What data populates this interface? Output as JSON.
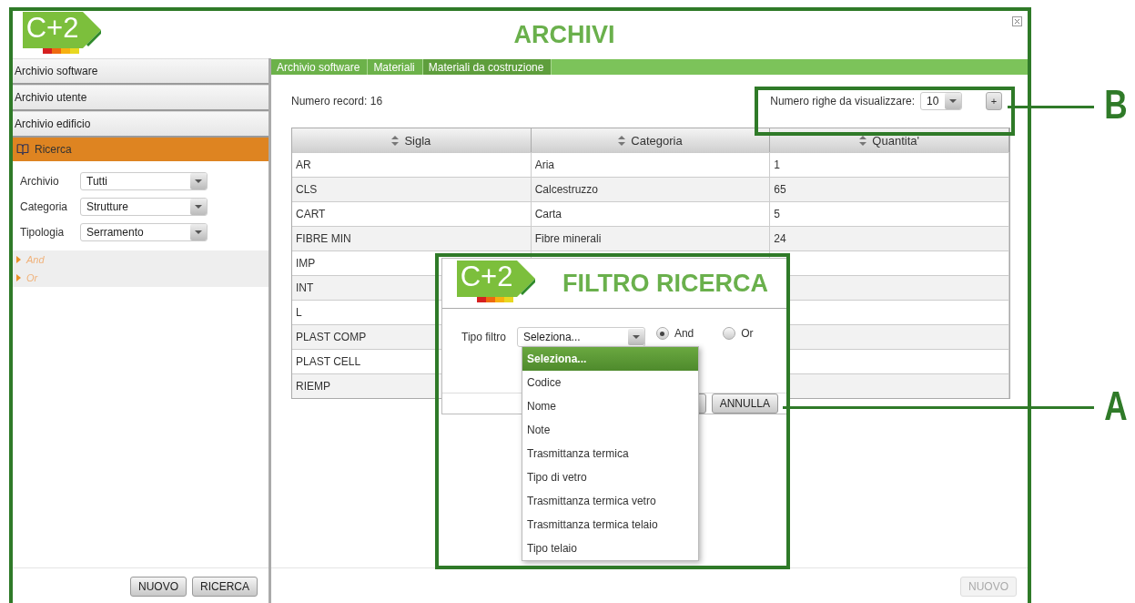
{
  "window": {
    "title": "ARCHIVI",
    "logo": "C+2"
  },
  "sidebar": {
    "sections": [
      {
        "label": "Archivio software"
      },
      {
        "label": "Archivio utente"
      },
      {
        "label": "Archivio edificio"
      }
    ],
    "search": {
      "title": "Ricerca",
      "fields": [
        {
          "label": "Archivio",
          "value": "Tutti"
        },
        {
          "label": "Categoria",
          "value": "Strutture"
        },
        {
          "label": "Tipologia",
          "value": "Serramento"
        }
      ],
      "operators": [
        {
          "label": "And"
        },
        {
          "label": "Or"
        }
      ],
      "buttons": [
        {
          "label": "NUOVO",
          "disabled": false
        },
        {
          "label": "RICERCA",
          "disabled": false
        }
      ]
    }
  },
  "main": {
    "breadcrumb": [
      {
        "label": "Archivio software",
        "selected": false
      },
      {
        "label": "Materiali",
        "selected": false
      },
      {
        "label": "Materiali da costruzione",
        "selected": true
      }
    ],
    "record_count": {
      "label": "Numero record:",
      "value": "16"
    },
    "rows_per_page": {
      "label": "Numero righe da visualizzare:",
      "value": "10",
      "button": "+"
    },
    "table": {
      "columns": [
        "Sigla",
        "Categoria",
        "Quantita'"
      ],
      "rows": [
        [
          "AR",
          "Aria",
          "1"
        ],
        [
          "CLS",
          "Calcestruzzo",
          "65"
        ],
        [
          "CART",
          "Carta",
          "5"
        ],
        [
          "FIBRE MIN",
          "Fibre minerali",
          "24"
        ],
        [
          "IMP"
        ],
        [
          "INT"
        ],
        [
          "L"
        ],
        [
          "PLAST COMP"
        ],
        [
          "PLAST CELL"
        ],
        [
          "RIEMP"
        ]
      ]
    },
    "footer_button": {
      "label": "NUOVO",
      "disabled": true
    }
  },
  "dialog": {
    "title": "FILTRO RICERCA",
    "logo": "C+2",
    "filter": {
      "label": "Tipo filtro",
      "value": "Seleziona..."
    },
    "radios": [
      {
        "label": "And",
        "selected": true
      },
      {
        "label": "Or",
        "selected": false
      }
    ],
    "buttons": [
      "ANNULLA"
    ],
    "dropdown": [
      {
        "label": "Seleziona...",
        "selected": true
      },
      {
        "label": "Codice",
        "selected": false
      },
      {
        "label": "Nome",
        "selected": false
      },
      {
        "label": "Note",
        "selected": false
      },
      {
        "label": "Trasmittanza termica",
        "selected": false
      },
      {
        "label": "Tipo di vetro",
        "selected": false
      },
      {
        "label": "Trasmittanza termica vetro",
        "selected": false
      },
      {
        "label": "Trasmittanza termica telaio",
        "selected": false
      },
      {
        "label": "Tipo telaio",
        "selected": false
      }
    ]
  },
  "annotations": [
    {
      "label": "B"
    },
    {
      "label": "A"
    }
  ]
}
